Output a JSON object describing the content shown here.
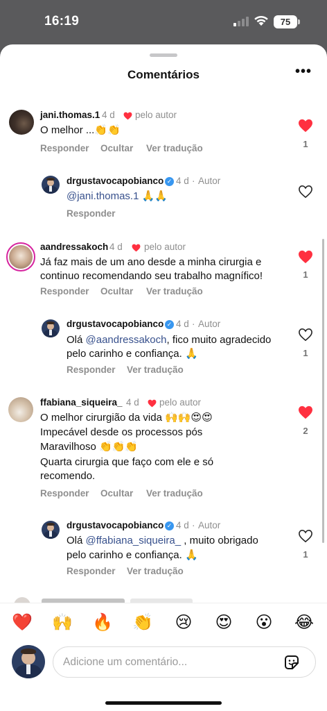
{
  "status": {
    "time": "16:19",
    "battery": "75"
  },
  "sheet": {
    "title": "Comentários"
  },
  "comments": [
    {
      "username": "jani.thomas.1",
      "age": "4 d",
      "liked_by_author": "pelo autor",
      "text": [
        "O melhor ...👏👏"
      ],
      "actions": {
        "reply": "Responder",
        "hide": "Ocultar",
        "translate": "Ver tradução"
      },
      "likes": "1",
      "reply": {
        "username": "drgustavocapobianco",
        "age": "4 d",
        "author_tag": "Autor",
        "mention": "@jani.thomas.1",
        "text_after": " 🙏🙏",
        "actions": {
          "reply": "Responder"
        }
      }
    },
    {
      "username": "aandressakoch",
      "age": "4 d",
      "liked_by_author": "pelo autor",
      "text": [
        "Já faz mais de um ano desde a minha cirurgia e",
        "continuo recomendando seu trabalho magnífico!"
      ],
      "actions": {
        "reply": "Responder",
        "hide": "Ocultar",
        "translate": "Ver tradução"
      },
      "likes": "1",
      "reply": {
        "username": "drgustavocapobianco",
        "age": "4 d",
        "author_tag": "Autor",
        "text_before": "Olá ",
        "mention": "@aandressakoch",
        "text_after": ", fico muito agradecido",
        "text_line2": "pelo carinho e confiança. 🙏",
        "actions": {
          "reply": "Responder",
          "translate": "Ver tradução"
        },
        "likes": "1"
      }
    },
    {
      "username": "ffabiana_siqueira_",
      "age": "4 d",
      "liked_by_author": "pelo autor",
      "text": [
        "O melhor cirurgião da vida 🙌🙌😍😍",
        "Impecável desde os processos pós",
        "Maravilhoso 👏👏👏",
        "Quarta cirurgia que faço com ele e só",
        "recomendo."
      ],
      "actions": {
        "reply": "Responder",
        "hide": "Ocultar",
        "translate": "Ver tradução"
      },
      "likes": "2",
      "reply": {
        "username": "drgustavocapobianco",
        "age": "4 d",
        "author_tag": "Autor",
        "text_before": "Olá ",
        "mention": "@ffabiana_siqueira_",
        "text_after": " , muito obrigado",
        "text_line2": "pelo carinho e confiança. 🙏",
        "actions": {
          "reply": "Responder",
          "translate": "Ver tradução"
        },
        "likes": "1"
      }
    }
  ],
  "emoji_bar": [
    "❤️",
    "🙌",
    "🔥",
    "👏",
    "😢",
    "😍",
    "😮",
    "😂"
  ],
  "composer": {
    "placeholder": "Adicione um comentário..."
  },
  "colors": {
    "like_red": "#ff3040",
    "mention": "#38518d",
    "verified": "#3897f0"
  }
}
